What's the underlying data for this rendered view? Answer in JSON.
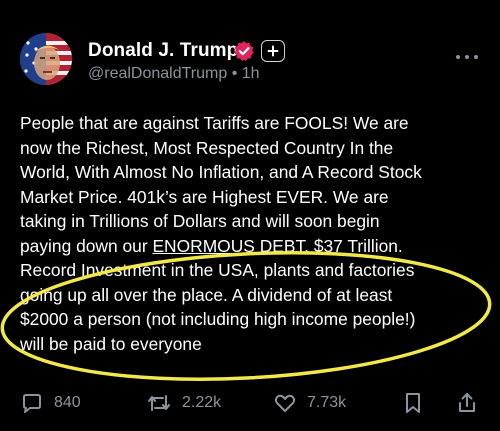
{
  "author": {
    "name": "Donald J. Trump",
    "handle": "@realDonaldTrump",
    "separator": "•",
    "time": "1h"
  },
  "post": {
    "lines": [
      "People that are against Tariffs are FOOLS! We are",
      "now the Richest, Most Respected Country In the",
      "World, With Almost No Inflation, and A Record Stock",
      "Market Price. 401k’s are Highest EVER. We are",
      "taking in Trillions of Dollars and will soon begin",
      "paying down our ",
      "ENORMOUS DEBT",
      ", $37 Trillion.",
      "Record Investment in the USA, plants and factories",
      "going up all over the place. A dividend of at least",
      "$2000 a person (not including high income people!)",
      "will be paid to everyone"
    ]
  },
  "stats": {
    "replies": "840",
    "reposts": "2.22k",
    "likes": "7.73k"
  },
  "icons": {
    "avatar": "flag-portrait-avatar",
    "verified": "verified-badge-icon",
    "plus": "plus-icon",
    "more": "more-icon",
    "reply": "reply-icon",
    "repost": "repost-icon",
    "like": "heart-icon",
    "bookmark": "bookmark-icon",
    "share": "share-icon"
  },
  "colors": {
    "background": "#000000",
    "text": "#ffffff",
    "muted": "#8b949e",
    "verified": "#e0245e",
    "highlight": "#f2e84a"
  }
}
